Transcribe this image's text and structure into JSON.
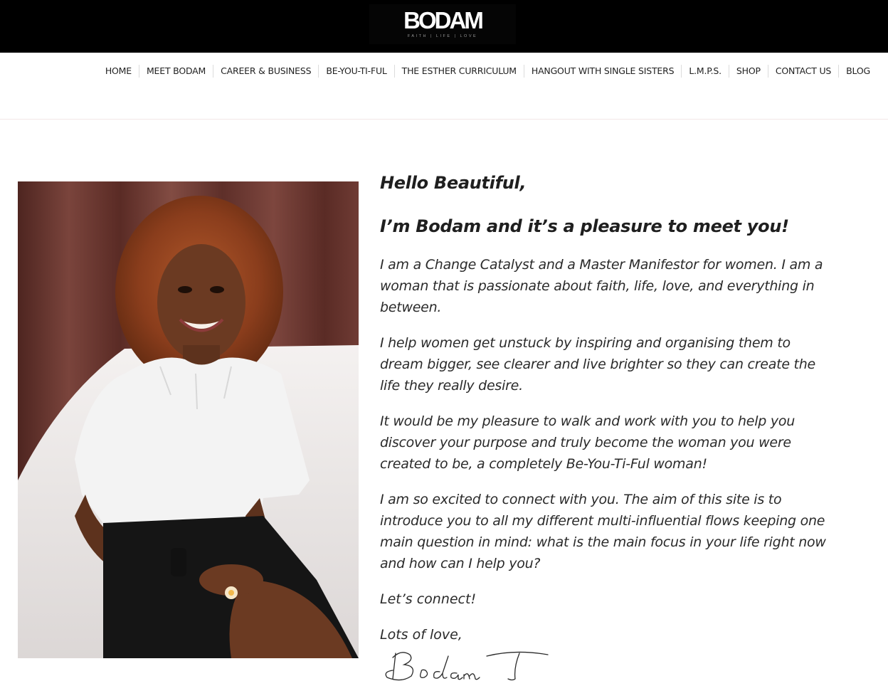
{
  "header": {
    "logo_text": "BODAM",
    "logo_tagline": "FAITH | LIFE | LOVE"
  },
  "nav": {
    "items": [
      {
        "label": "HOME"
      },
      {
        "label": "MEET BODAM"
      },
      {
        "label": "CAREER & BUSINESS"
      },
      {
        "label": "BE-YOU-TI-FUL"
      },
      {
        "label": "THE ESTHER CURRICULUM"
      },
      {
        "label": "HANGOUT WITH SINGLE SISTERS"
      },
      {
        "label": "L.M.P.S."
      },
      {
        "label": "SHOP"
      },
      {
        "label": "CONTACT US"
      },
      {
        "label": "BLOG"
      }
    ]
  },
  "content": {
    "greeting": "Hello Beautiful,",
    "intro": "I’m Bodam and it’s a pleasure to meet you!",
    "paragraphs": [
      "I am a Change Catalyst and a Master Manifestor for women.  I am a woman that is passionate about faith, life, love, and everything in between.",
      "I help women get unstuck by inspiring and organising them to dream bigger, see clearer and live brighter so they can create the life they really desire.",
      "It would be my pleasure to walk and work with you to help you discover your purpose and truly become the woman you were created to be, a completely Be-You-Ti-Ful woman!",
      "I am so excited to connect with you.  The aim of this site is to introduce you to all my different multi-influential flows keeping one main question in mind: what is the main focus in your life right now and how can I help you?"
    ],
    "connect": "Let’s connect!",
    "sign_off": "Lots of love,",
    "signature": "Bodam T."
  },
  "colors": {
    "header_bg": "#000000",
    "text": "#222222",
    "nav_divider": "#dcdcdc",
    "curtain": "#6e3a33"
  }
}
